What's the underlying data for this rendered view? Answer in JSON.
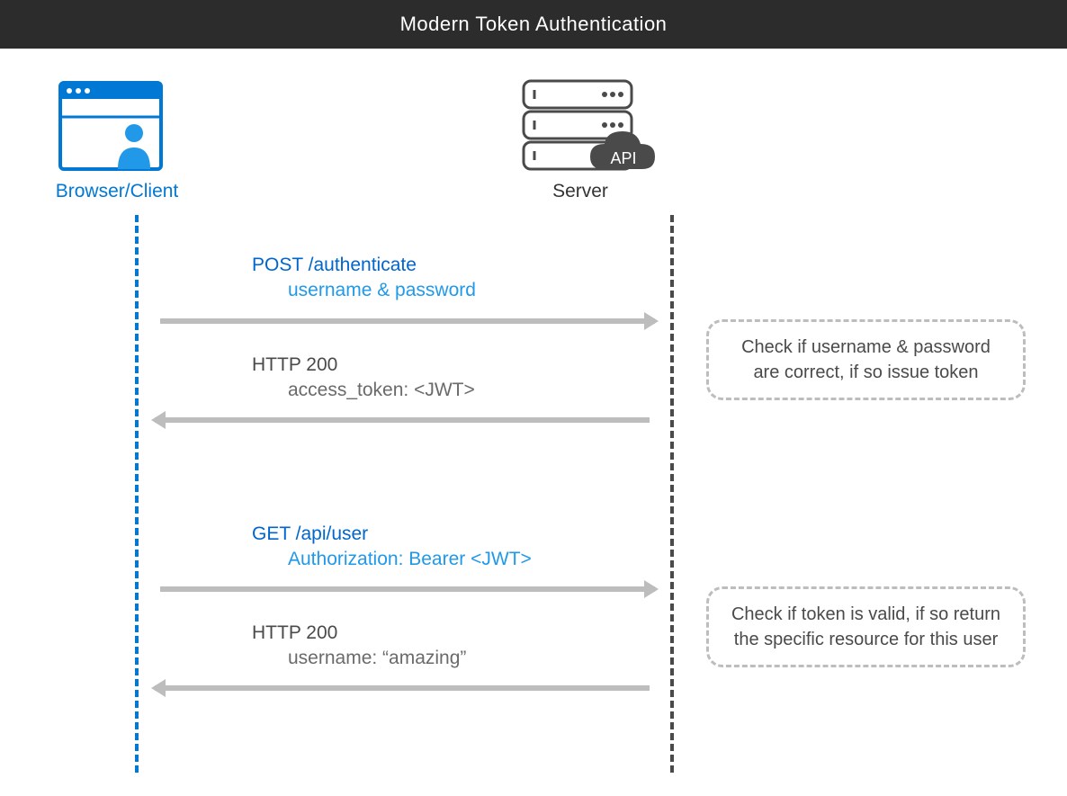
{
  "title": "Modern Token Authentication",
  "actors": {
    "client": {
      "label": "Browser/Client"
    },
    "server": {
      "label": "Server",
      "api_badge": "API"
    }
  },
  "messages": [
    {
      "title": "POST /authenticate",
      "subtitle": "username & password"
    },
    {
      "title": "HTTP 200",
      "subtitle": "access_token: <JWT>"
    },
    {
      "title": "GET /api/user",
      "subtitle": "Authorization: Bearer <JWT>"
    },
    {
      "title": "HTTP 200",
      "subtitle": "username: “amazing”"
    }
  ],
  "notes": [
    "Check if username & password are correct, if so issue token",
    "Check if token is valid, if so return the specific resource for this user"
  ]
}
